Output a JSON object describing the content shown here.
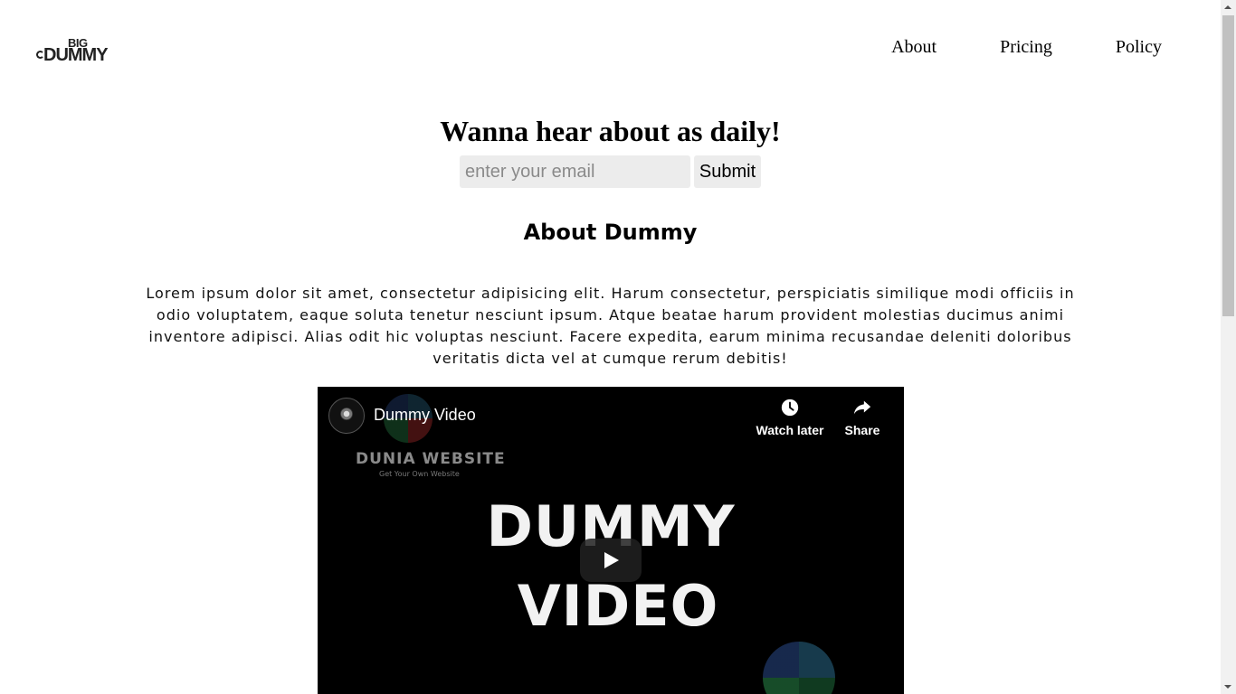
{
  "header": {
    "logo": {
      "top_text": "BIG",
      "main_text": "DUMMY"
    },
    "nav": [
      {
        "label": "About"
      },
      {
        "label": "Pricing"
      },
      {
        "label": "Policy"
      }
    ]
  },
  "newsletter": {
    "headline": "Wanna hear about as daily!",
    "email_placeholder": "enter your email",
    "submit_label": "Submit"
  },
  "about": {
    "title": "About Dummy",
    "body": "Lorem ipsum dolor sit amet, consectetur adipisicing elit. Harum consectetur, perspiciatis similique modi officiis in odio voluptatem, eaque soluta tenetur nesciunt ipsum. Atque beatae harum provident molestias ducimus animi inventore adipisci. Alias odit hic voluptas nesciunt. Facere expedita, earum minima recusandae deleniti doloribus veritatis dicta vel at cumque rerum debitis!"
  },
  "video": {
    "title": "Dummy Video",
    "watch_later_label": "Watch later",
    "share_label": "Share",
    "thumbnail": {
      "line1": "DUMMY",
      "line2": "VIDEO",
      "watermark": "DUNIA WEBSITE",
      "watermark_sub": "Get Your Own Website"
    }
  },
  "icons": [
    "clock-icon",
    "share-arrow-icon",
    "play-icon",
    "scroll-up-arrow-icon",
    "scroll-down-arrow-icon"
  ]
}
